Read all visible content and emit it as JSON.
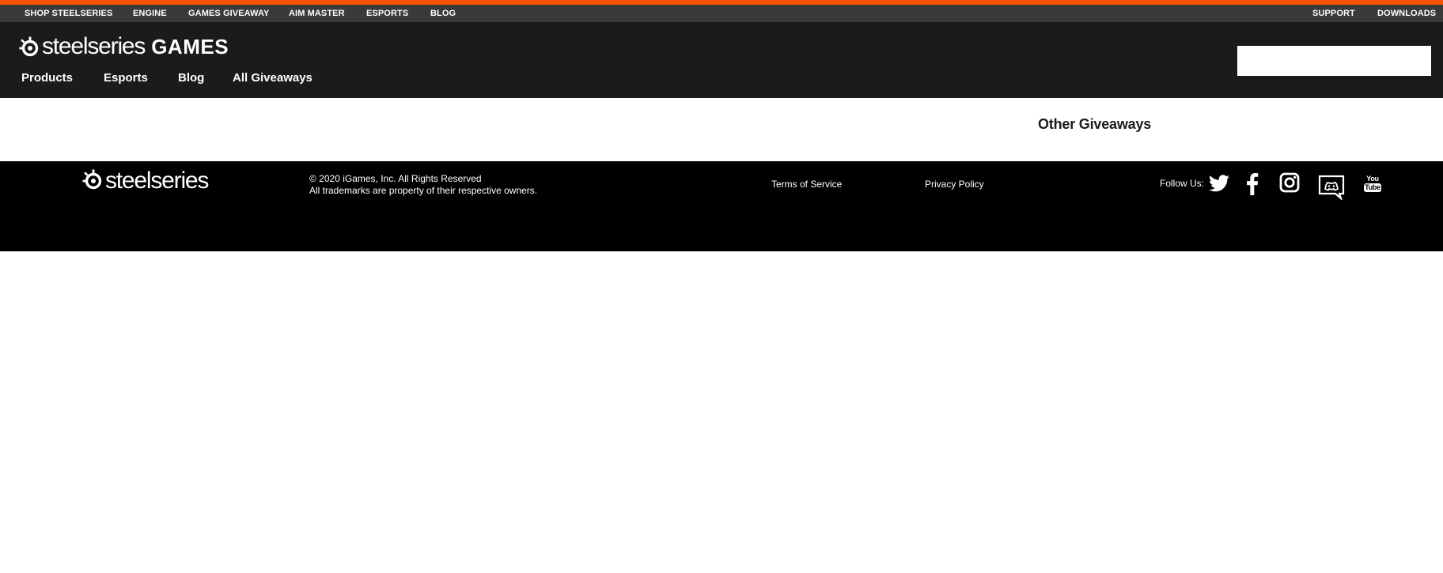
{
  "colors": {
    "accent": "#ff5200",
    "topnav_bg": "#3a3a3a",
    "header_bg": "#1b1b1b",
    "footer_bg": "#000000",
    "text_light": "#ffffff"
  },
  "topnav": {
    "left_items": [
      "SHOP STEELSERIES",
      "ENGINE",
      "GAMES GIVEAWAY",
      "AIM MASTER",
      "ESPORTS",
      "BLOG"
    ],
    "right_items": [
      "SUPPORT",
      "DOWNLOADS"
    ]
  },
  "header": {
    "logo_wordmark": "steelseries",
    "logo_suffix": "GAMES",
    "nav": [
      "Products",
      "Esports",
      "Blog",
      "All Giveaways"
    ],
    "search_value": ""
  },
  "main": {
    "other_giveaways_heading": "Other Giveaways"
  },
  "footer": {
    "logo_wordmark": "steelseries",
    "copyright_line1": "© 2020 iGames, Inc. All Rights Reserved",
    "copyright_line2": "All trademarks are property of their respective owners.",
    "terms_label": "Terms of Service",
    "privacy_label": "Privacy Policy",
    "follow_label": "Follow Us:",
    "social_icons": [
      "twitter-icon",
      "facebook-icon",
      "instagram-icon",
      "discord-icon",
      "youtube-icon"
    ],
    "youtube_icon_text_top": "You",
    "youtube_icon_text_bottom": "Tube"
  }
}
